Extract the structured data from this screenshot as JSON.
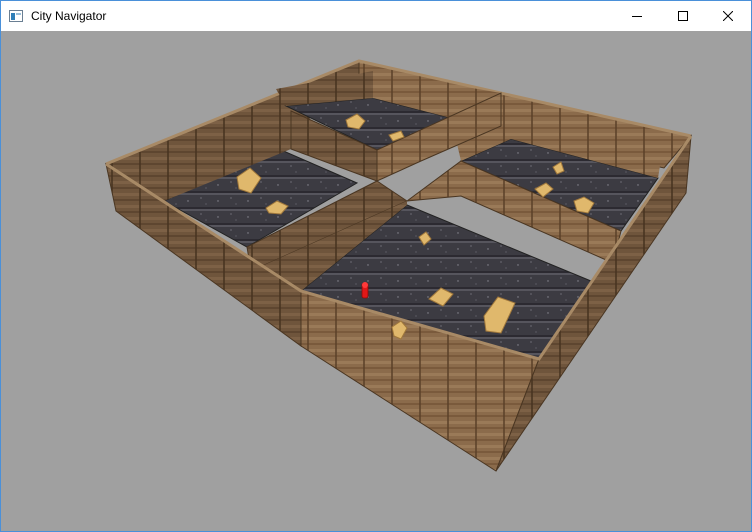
{
  "window": {
    "title": "City Navigator",
    "controls": {
      "minimize_icon": "minimize-icon",
      "maximize_icon": "maximize-icon",
      "close_icon": "close-icon"
    }
  },
  "scene": {
    "background_color": "#a0a0a0",
    "wall_color": "#8a6a4a",
    "floor_color": "#3e3d44",
    "item_color": "#e0b86c",
    "player_color": "#e01818",
    "rooms": 4,
    "collectibles": 10,
    "player": "red-marker"
  }
}
